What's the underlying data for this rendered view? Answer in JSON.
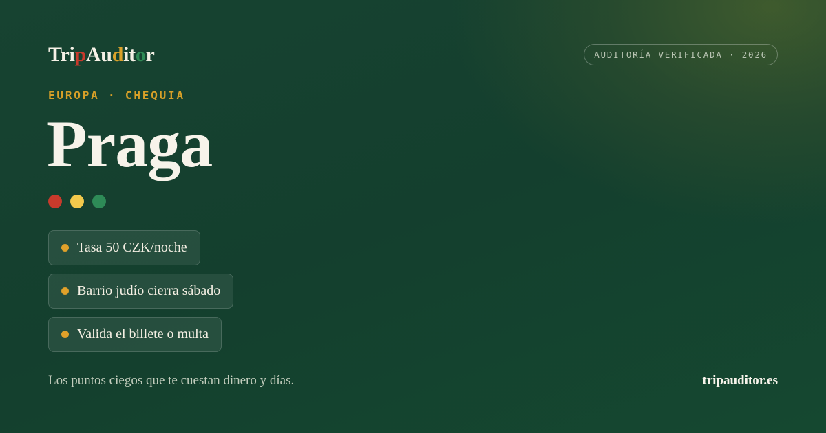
{
  "brand": {
    "segments": [
      {
        "text": "Tri",
        "color": "#f5f1e6"
      },
      {
        "text": "p",
        "color": "#c83a2c"
      },
      {
        "text": "Au",
        "color": "#f5f1e6"
      },
      {
        "text": "d",
        "color": "#d9a12a"
      },
      {
        "text": "it",
        "color": "#f5f1e6"
      },
      {
        "text": "o",
        "color": "#2f8a55"
      },
      {
        "text": "r",
        "color": "#f5f1e6"
      }
    ]
  },
  "badge": {
    "label": "AUDITORÍA VERIFICADA · 2026"
  },
  "region": {
    "label": "EUROPA · CHEQUIA"
  },
  "city": {
    "name": "Praga"
  },
  "dots": {
    "colors": [
      "#c83a2c",
      "#f2c94c",
      "#2e8b57"
    ]
  },
  "tips": [
    {
      "text": "Tasa 50 CZK/noche"
    },
    {
      "text": "Barrio judío cierra sábado"
    },
    {
      "text": "Valida el billete o multa"
    }
  ],
  "footer": {
    "tagline": "Los puntos ciegos que te cuestan dinero y días.",
    "site": "tripauditor.es"
  }
}
